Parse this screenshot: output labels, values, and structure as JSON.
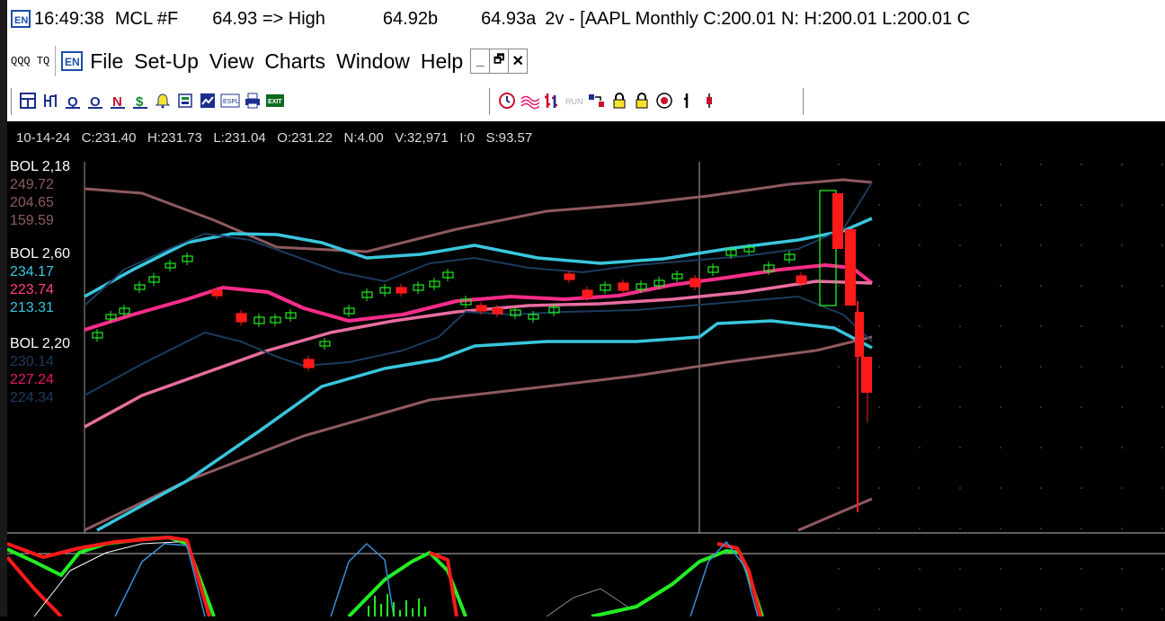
{
  "title_bar": {
    "time": "16:49:38",
    "symbol": "MCL #F",
    "quote": "64.93 => High",
    "bid": "64.92b",
    "ask": "64.93a",
    "window_title": "2v - [AAPL Monthly C:200.01 N: H:200.01 L:200.01 C"
  },
  "menu": {
    "quote_symbol": "QQQ TQ",
    "items": [
      "File",
      "Set-Up",
      "View",
      "Charts",
      "Window",
      "Help"
    ],
    "window_buttons": [
      "_",
      "🗗",
      "✕"
    ]
  },
  "toolbar": {
    "group1": [
      "layout-icon",
      "indicator-icon",
      "Q",
      "O",
      "N",
      "$",
      "alert-icon",
      "sheet-icon",
      "chart-icon",
      "ESPL",
      "print-icon",
      "EXIT"
    ],
    "group2": [
      "clock-icon",
      "waves-icon",
      "bars-icon",
      "RUN",
      "arrow-icon",
      "lock-icon",
      "lock-icon",
      "target-icon",
      "stick-icon",
      "candle-icon"
    ]
  },
  "chart_header": {
    "date": "10-14-24",
    "close": "C:231.40",
    "high": "H:231.73",
    "low": "L:231.04",
    "open": "O:231.22",
    "n": "N:4.00",
    "volume": "V:32,971",
    "i": "I:0",
    "s": "S:93.57"
  },
  "indicators": [
    {
      "label": "BOL 2,18",
      "values": [
        "249.72",
        "204.65",
        "159.59"
      ],
      "colors": [
        "#8f5a5e",
        "#8f5a5e",
        "#8f5a5e"
      ]
    },
    {
      "label": "BOL 2,60",
      "values": [
        "234.17",
        "223.74",
        "213.31"
      ],
      "colors": [
        "#39c6dd",
        "#ff3d8f",
        "#39c6dd"
      ]
    },
    {
      "label": "BOL 2,20",
      "values": [
        "230.14",
        "227.24",
        "224.34"
      ],
      "colors": [
        "#1c3b5e",
        "#e8166f",
        "#1c3b5e"
      ]
    }
  ],
  "colors": {
    "up": "#22ee22",
    "down": "#ff1a1a",
    "outer_band": "#8f5a5e",
    "mid_band": "#39c6dd",
    "mid_avg": "#ff2d8a",
    "inner_band": "#1c3b5e",
    "ma_pink": "#e86ea0"
  }
}
